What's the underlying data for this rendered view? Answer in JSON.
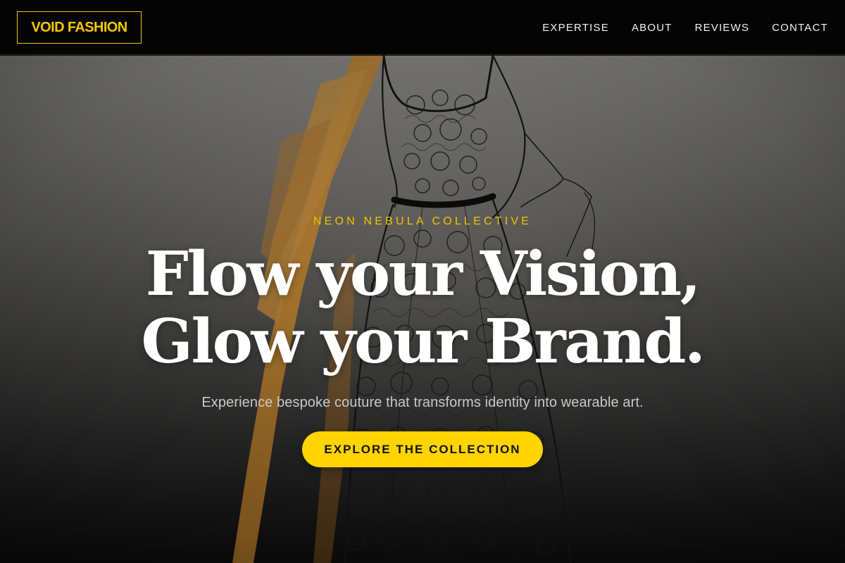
{
  "header": {
    "logo_text": "VOID FASHION",
    "nav": [
      {
        "label": "EXPERTISE"
      },
      {
        "label": "ABOUT"
      },
      {
        "label": "REVIEWS"
      },
      {
        "label": "CONTACT"
      }
    ]
  },
  "hero": {
    "eyebrow": "NEON NEBULA COLLECTIVE",
    "headline_line1": "Flow your Vision,",
    "headline_line2": "Glow your Brand.",
    "subtext": "Experience bespoke couture that transforms identity into wearable art.",
    "cta_label": "EXPLORE THE COLLECTION",
    "background_image": "fashion-sketch-lace-dress"
  },
  "colors": {
    "accent": "#FFD400",
    "header_bg": "#040404",
    "text_primary": "#FFFFFF",
    "text_muted": "#C9C9C9"
  }
}
